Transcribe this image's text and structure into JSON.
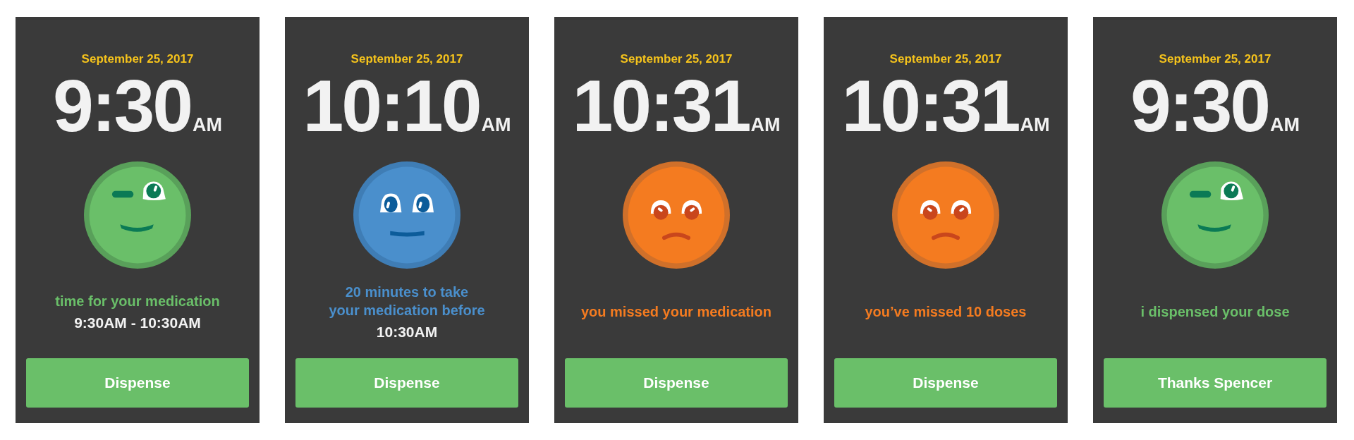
{
  "screens": [
    {
      "date": "September 25, 2017",
      "time": "9:30",
      "meridiem": "AM",
      "kind": "wink",
      "color": "#6abf69",
      "message": "time for your medication",
      "detail": "9:30AM - 10:30AM",
      "button": "Dispense"
    },
    {
      "date": "September 25, 2017",
      "time": "10:10",
      "meridiem": "AM",
      "kind": "neutral",
      "color": "#4a8fcc",
      "message": "20 minutes to take\nyour medication before",
      "detail": "10:30AM",
      "button": "Dispense"
    },
    {
      "date": "September 25, 2017",
      "time": "10:31",
      "meridiem": "AM",
      "kind": "sad",
      "color": "#f47b20",
      "message": "you missed your medication",
      "button": "Dispense"
    },
    {
      "date": "September 25, 2017",
      "time": "10:31",
      "meridiem": "AM",
      "kind": "sad",
      "color": "#f47b20",
      "message": "you’ve missed 10 doses",
      "button": "Dispense"
    },
    {
      "date": "September 25, 2017",
      "time": "9:30",
      "meridiem": "AM",
      "kind": "wink",
      "color": "#6abf69",
      "message": "i dispensed your dose",
      "button": "Thanks Spencer"
    }
  ]
}
